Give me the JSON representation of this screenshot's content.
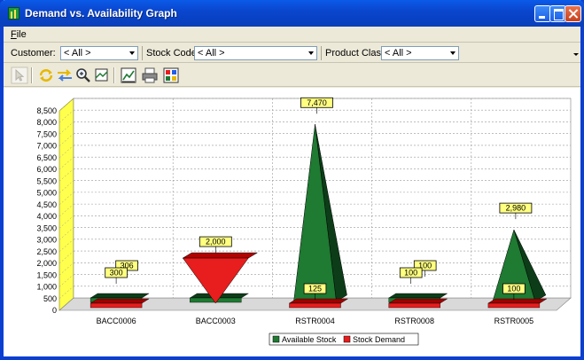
{
  "window": {
    "title": "Demand vs. Availability Graph"
  },
  "menu": {
    "file_label": "File"
  },
  "filters": {
    "customer_label": "Customer:",
    "customer_value": "< All >",
    "stock_code_label": "Stock Code:",
    "stock_code_value": "< All >",
    "product_class_label": "Product Class:",
    "product_class_value": "< All >"
  },
  "toolbar": {
    "icons": [
      "pointer-icon",
      "refresh-icon",
      "swap-icon",
      "zoom-icon",
      "zoom-window-icon",
      "chart-edit-icon",
      "print-icon",
      "palette-icon"
    ]
  },
  "chart_data": {
    "type": "bar",
    "title": "",
    "xlabel": "",
    "ylabel": "",
    "ylim": [
      0,
      8500
    ],
    "y_ticks": [
      "0",
      "500",
      "1,000",
      "1,500",
      "2,000",
      "2,500",
      "3,000",
      "3,500",
      "4,000",
      "4,500",
      "5,000",
      "5,500",
      "6,000",
      "6,500",
      "7,000",
      "7,500",
      "8,000",
      "8,500"
    ],
    "categories": [
      "BACC0006",
      "BACC0003",
      "RSTR0004",
      "RSTR0008",
      "RSTR0005"
    ],
    "series": [
      {
        "name": "Available Stock",
        "color": "#1f7a32",
        "values": [
          306,
          0,
          7470,
          100,
          2980
        ],
        "labels": [
          "306",
          "",
          "7,470",
          "100",
          "2,980"
        ]
      },
      {
        "name": "Stock Demand",
        "color": "#e81d1d",
        "values": [
          300,
          2000,
          125,
          100,
          100
        ],
        "labels": [
          "300",
          "2,000",
          "125",
          "100",
          "100"
        ]
      }
    ],
    "grid": true,
    "legend_position": "bottom"
  }
}
